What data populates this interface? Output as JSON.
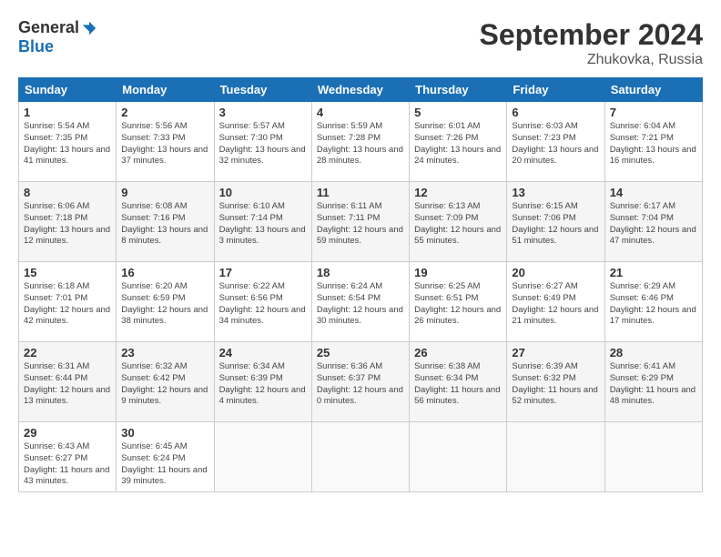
{
  "logo": {
    "general": "General",
    "blue": "Blue"
  },
  "title": "September 2024",
  "location": "Zhukovka, Russia",
  "days_of_week": [
    "Sunday",
    "Monday",
    "Tuesday",
    "Wednesday",
    "Thursday",
    "Friday",
    "Saturday"
  ],
  "weeks": [
    [
      {
        "day": "1",
        "info": "Sunrise: 5:54 AM\nSunset: 7:35 PM\nDaylight: 13 hours\nand 41 minutes."
      },
      {
        "day": "2",
        "info": "Sunrise: 5:56 AM\nSunset: 7:33 PM\nDaylight: 13 hours\nand 37 minutes."
      },
      {
        "day": "3",
        "info": "Sunrise: 5:57 AM\nSunset: 7:30 PM\nDaylight: 13 hours\nand 32 minutes."
      },
      {
        "day": "4",
        "info": "Sunrise: 5:59 AM\nSunset: 7:28 PM\nDaylight: 13 hours\nand 28 minutes."
      },
      {
        "day": "5",
        "info": "Sunrise: 6:01 AM\nSunset: 7:26 PM\nDaylight: 13 hours\nand 24 minutes."
      },
      {
        "day": "6",
        "info": "Sunrise: 6:03 AM\nSunset: 7:23 PM\nDaylight: 13 hours\nand 20 minutes."
      },
      {
        "day": "7",
        "info": "Sunrise: 6:04 AM\nSunset: 7:21 PM\nDaylight: 13 hours\nand 16 minutes."
      }
    ],
    [
      {
        "day": "8",
        "info": "Sunrise: 6:06 AM\nSunset: 7:18 PM\nDaylight: 13 hours\nand 12 minutes."
      },
      {
        "day": "9",
        "info": "Sunrise: 6:08 AM\nSunset: 7:16 PM\nDaylight: 13 hours\nand 8 minutes."
      },
      {
        "day": "10",
        "info": "Sunrise: 6:10 AM\nSunset: 7:14 PM\nDaylight: 13 hours\nand 3 minutes."
      },
      {
        "day": "11",
        "info": "Sunrise: 6:11 AM\nSunset: 7:11 PM\nDaylight: 12 hours\nand 59 minutes."
      },
      {
        "day": "12",
        "info": "Sunrise: 6:13 AM\nSunset: 7:09 PM\nDaylight: 12 hours\nand 55 minutes."
      },
      {
        "day": "13",
        "info": "Sunrise: 6:15 AM\nSunset: 7:06 PM\nDaylight: 12 hours\nand 51 minutes."
      },
      {
        "day": "14",
        "info": "Sunrise: 6:17 AM\nSunset: 7:04 PM\nDaylight: 12 hours\nand 47 minutes."
      }
    ],
    [
      {
        "day": "15",
        "info": "Sunrise: 6:18 AM\nSunset: 7:01 PM\nDaylight: 12 hours\nand 42 minutes."
      },
      {
        "day": "16",
        "info": "Sunrise: 6:20 AM\nSunset: 6:59 PM\nDaylight: 12 hours\nand 38 minutes."
      },
      {
        "day": "17",
        "info": "Sunrise: 6:22 AM\nSunset: 6:56 PM\nDaylight: 12 hours\nand 34 minutes."
      },
      {
        "day": "18",
        "info": "Sunrise: 6:24 AM\nSunset: 6:54 PM\nDaylight: 12 hours\nand 30 minutes."
      },
      {
        "day": "19",
        "info": "Sunrise: 6:25 AM\nSunset: 6:51 PM\nDaylight: 12 hours\nand 26 minutes."
      },
      {
        "day": "20",
        "info": "Sunrise: 6:27 AM\nSunset: 6:49 PM\nDaylight: 12 hours\nand 21 minutes."
      },
      {
        "day": "21",
        "info": "Sunrise: 6:29 AM\nSunset: 6:46 PM\nDaylight: 12 hours\nand 17 minutes."
      }
    ],
    [
      {
        "day": "22",
        "info": "Sunrise: 6:31 AM\nSunset: 6:44 PM\nDaylight: 12 hours\nand 13 minutes."
      },
      {
        "day": "23",
        "info": "Sunrise: 6:32 AM\nSunset: 6:42 PM\nDaylight: 12 hours\nand 9 minutes."
      },
      {
        "day": "24",
        "info": "Sunrise: 6:34 AM\nSunset: 6:39 PM\nDaylight: 12 hours\nand 4 minutes."
      },
      {
        "day": "25",
        "info": "Sunrise: 6:36 AM\nSunset: 6:37 PM\nDaylight: 12 hours\nand 0 minutes."
      },
      {
        "day": "26",
        "info": "Sunrise: 6:38 AM\nSunset: 6:34 PM\nDaylight: 11 hours\nand 56 minutes."
      },
      {
        "day": "27",
        "info": "Sunrise: 6:39 AM\nSunset: 6:32 PM\nDaylight: 11 hours\nand 52 minutes."
      },
      {
        "day": "28",
        "info": "Sunrise: 6:41 AM\nSunset: 6:29 PM\nDaylight: 11 hours\nand 48 minutes."
      }
    ],
    [
      {
        "day": "29",
        "info": "Sunrise: 6:43 AM\nSunset: 6:27 PM\nDaylight: 11 hours\nand 43 minutes."
      },
      {
        "day": "30",
        "info": "Sunrise: 6:45 AM\nSunset: 6:24 PM\nDaylight: 11 hours\nand 39 minutes."
      },
      {
        "day": "",
        "info": ""
      },
      {
        "day": "",
        "info": ""
      },
      {
        "day": "",
        "info": ""
      },
      {
        "day": "",
        "info": ""
      },
      {
        "day": "",
        "info": ""
      }
    ]
  ]
}
